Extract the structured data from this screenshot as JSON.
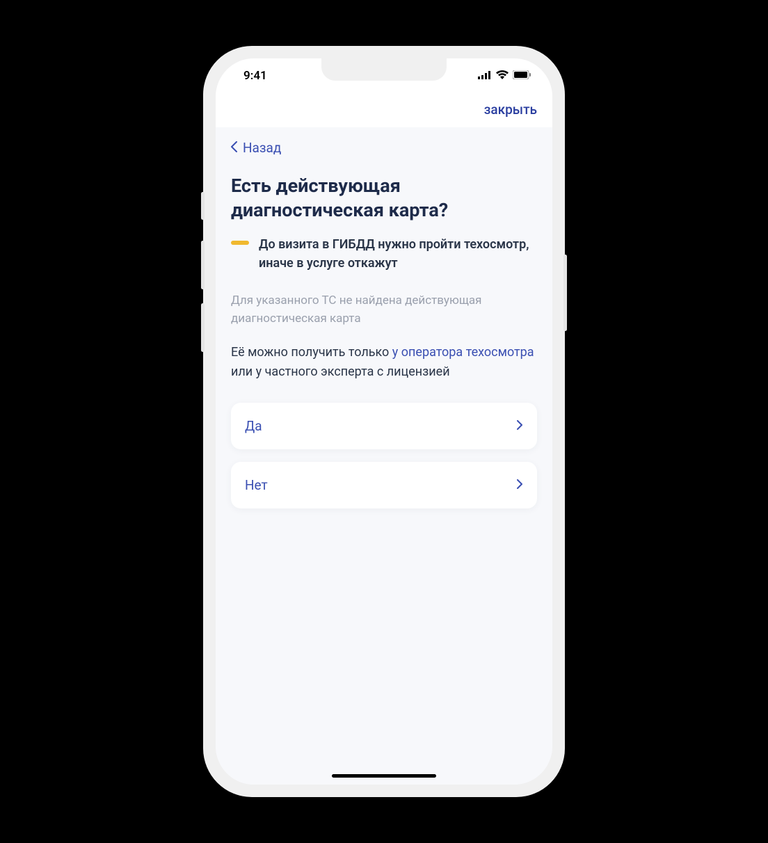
{
  "statusBar": {
    "time": "9:41"
  },
  "topBar": {
    "close": "закрыть"
  },
  "nav": {
    "back": "Назад"
  },
  "heading": "Есть действующая диагностическая карта?",
  "warning": "До визита в ГИБДД нужно пройти техосмотр, иначе в услуге откажут",
  "muted": "Для указанного ТС не найдена действующая диагностическая карта",
  "info": {
    "prefix": "Её можно получить только ",
    "link": "у оператора техосмотра",
    "suffix": " или у частного эксперта с лицензией"
  },
  "options": {
    "yes": "Да",
    "no": "Нет"
  }
}
